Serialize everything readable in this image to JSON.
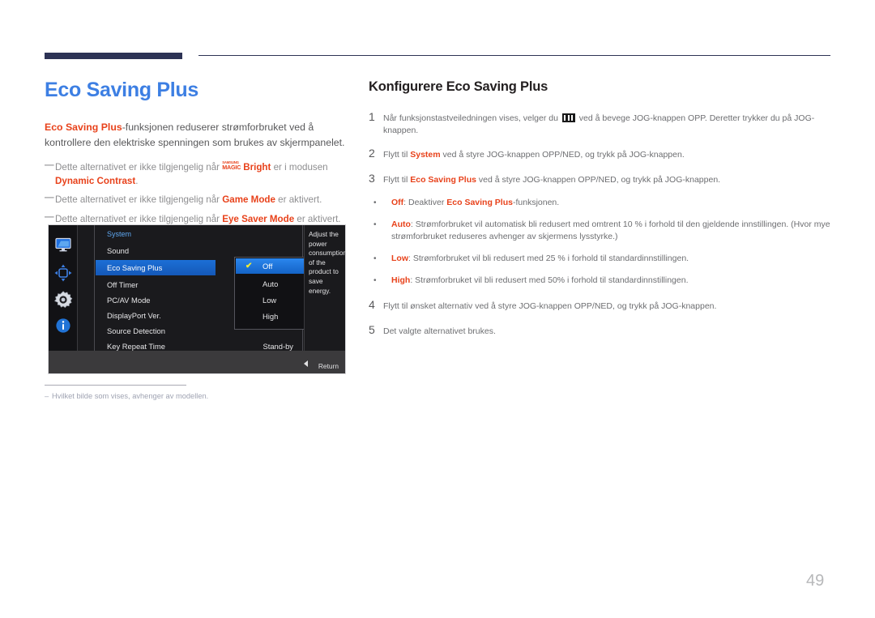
{
  "page": {
    "number": "49",
    "title": "Eco Saving Plus",
    "title_color": "#3d7fe3",
    "accent_color": "#e8421b",
    "header_bar_color": "#2d3355"
  },
  "left": {
    "intro_lead": "Eco Saving Plus",
    "intro_rest": "-funksjonen reduserer strømforbruket ved å kontrollere den elektriske spenningen som brukes av skjermpanelet.",
    "notes": [
      {
        "pre": "Dette alternativet er ikke tilgjengelig når ",
        "logo_top": "SAMSUNG",
        "logo_bottom": "MAGIC",
        "logo_suffix": "Bright",
        "mid": " er i modusen ",
        "strong": "Dynamic Contrast",
        "post": "."
      },
      {
        "pre": "Dette alternativet er ikke tilgjengelig når ",
        "strong": "Game Mode",
        "post": " er aktivert."
      },
      {
        "pre": "Dette alternativet er ikke tilgjengelig når ",
        "strong": "Eye Saver Mode",
        "post": " er aktivert."
      }
    ],
    "footnote": {
      "dash": "–",
      "text": "Hvilket bilde som vises, avhenger av modellen."
    }
  },
  "osd": {
    "sidebar_icons": [
      "monitor-icon",
      "navigation-arrows-icon",
      "gear-icon",
      "info-icon"
    ],
    "category": "System",
    "menu_items": [
      {
        "label": "Sound",
        "value": "",
        "selected": false
      },
      {
        "label": "Eco Saving Plus",
        "value": "",
        "selected": true
      },
      {
        "label": "Off Timer",
        "value": "",
        "selected": false
      },
      {
        "label": "PC/AV Mode",
        "value": "",
        "selected": false
      },
      {
        "label": "DisplayPort Ver.",
        "value": "",
        "selected": false
      },
      {
        "label": "Source Detection",
        "value": "",
        "selected": false
      },
      {
        "label": "Key Repeat Time",
        "value": "Stand-by",
        "selected": false
      }
    ],
    "submenu": [
      {
        "label": "Off",
        "checked": true
      },
      {
        "label": "Auto",
        "checked": false
      },
      {
        "label": "Low",
        "checked": false
      },
      {
        "label": "High",
        "checked": false
      }
    ],
    "description": "Adjust the power consumption of the product to save energy.",
    "return_label": "Return",
    "scroll_caret": "▼",
    "check_glyph": "✔"
  },
  "right": {
    "section_title": "Konfigurere Eco Saving Plus",
    "steps": [
      {
        "num": "1",
        "pre": "Når funksjonstastveiledningen vises, velger du ",
        "icon": "jog-menu-icon",
        "post": " ved å bevege JOG-knappen OPP. Deretter trykker du på JOG-knappen."
      },
      {
        "num": "2",
        "pre": "Flytt til ",
        "strong": "System",
        "post": " ved å styre JOG-knappen OPP/NED, og trykk på JOG-knappen."
      },
      {
        "num": "3",
        "pre": "Flytt til ",
        "strong": "Eco Saving Plus",
        "post": " ved å styre JOG-knappen OPP/NED, og trykk på JOG-knappen."
      }
    ],
    "bullets": [
      {
        "dot": "•",
        "strong": "Off",
        "text": ": Deaktiver ",
        "strong2": "Eco Saving Plus",
        "text2": "-funksjonen."
      },
      {
        "dot": "•",
        "strong": "Auto",
        "text": ": Strømforbruket vil automatisk bli redusert med omtrent 10 % i forhold til den gjeldende innstillingen. (Hvor mye strømforbruket reduseres avhenger av skjermens lysstyrke.)"
      },
      {
        "dot": "•",
        "strong": "Low",
        "text": ": Strømforbruket vil bli redusert med 25 % i forhold til standardinnstillingen."
      },
      {
        "dot": "•",
        "strong": "High",
        "text": ": Strømforbruket vil bli redusert med 50% i forhold til standardinnstillingen."
      }
    ],
    "steps_tail": [
      {
        "num": "4",
        "text": "Flytt til ønsket alternativ ved å styre JOG-knappen OPP/NED, og trykk på JOG-knappen."
      },
      {
        "num": "5",
        "text": "Det valgte alternativet brukes."
      }
    ]
  }
}
